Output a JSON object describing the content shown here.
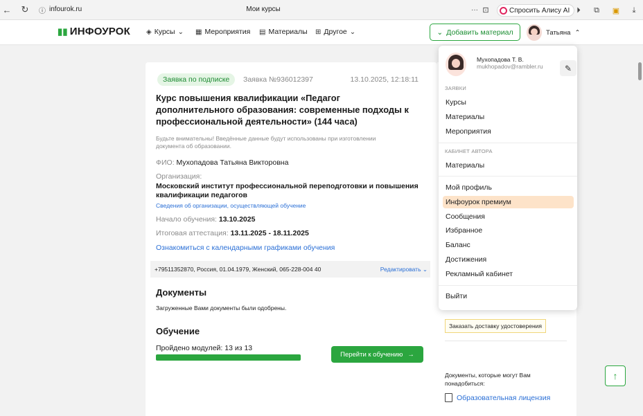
{
  "browser": {
    "url": "infourok.ru",
    "page_title": "Мои курсы",
    "alice_button": "Спросить Алису AI"
  },
  "header": {
    "logo": "ИНФОУРОК",
    "nav": [
      "Курсы",
      "Мероприятия",
      "Материалы",
      "Другое"
    ],
    "add_material": "Добавить материал",
    "user_name": "Татьяна"
  },
  "application": {
    "badge": "Заявка по подписке",
    "number": "Заявка №936012397",
    "date": "13.10.2025, 12:18:11",
    "title": "Курс повышения квалификации «Педагог дополнительного образования: современные подходы к профессиональной деятельности» (144 часа)",
    "note": "Будьте внимательны! Введённые данные будут использованы при изготовлении документа об образовании.",
    "fio_label": "ФИО:",
    "fio": "Мухопадова Татьяна Викторовна",
    "org_label": "Организация:",
    "org": "Московский институт профессиональной переподготовки и повышения квалификации педагогов",
    "org_link": "Сведения об организации, осуществляющей обучение",
    "start_label": "Начало обучения:",
    "start": "13.10.2025",
    "final_label": "Итоговая аттестация:",
    "final": "13.11.2025 - 18.11.2025",
    "calendar_link": "Ознакомиться с календарными графиками обучения",
    "info": "+79511352870, Россия, 01.04.1979, Женский, 065-228-004 40",
    "edit": "Редактировать",
    "docs_title": "Документы",
    "docs_text": "Загруженные Вами документы были одобрены.",
    "study_title": "Обучение",
    "modules": "Пройдено модулей: 13 из 13",
    "progress": 1.0,
    "go_button": "Перейти к обучению"
  },
  "sidebar": {
    "order_delivery": "Заказать доставку удостоверения",
    "docs_note": "Документы, которые могут Вам понадобиться:",
    "license_link": "Образовательная лицензия"
  },
  "dropdown": {
    "name": "Мухопадова Т. В.",
    "email": "mukhopadov@rambler.ru",
    "sections": [
      {
        "title": "ЗАЯВКИ",
        "items": [
          "Курсы",
          "Материалы",
          "Мероприятия"
        ]
      },
      {
        "title": "КАБИНЕТ АВТОРА",
        "items": [
          "Материалы"
        ]
      }
    ],
    "menu": [
      "Мой профиль",
      "Инфоурок премиум",
      "Сообщения",
      "Избранное",
      "Баланс",
      "Достижения",
      "Рекламный кабинет"
    ],
    "highlighted": "Инфоурок премиум",
    "logout": "Выйти",
    "highlight_color": "#fde3c9"
  },
  "colors": {
    "accent": "#2ba63f",
    "link": "#2a6fd6"
  }
}
